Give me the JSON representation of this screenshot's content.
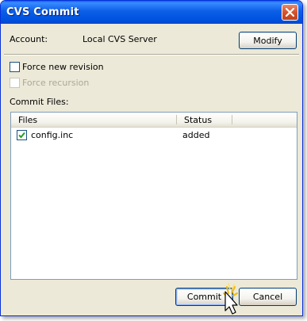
{
  "window": {
    "title": "CVS Commit"
  },
  "account": {
    "label": "Account:",
    "value": "Local CVS Server",
    "modify_label": "Modify"
  },
  "options": {
    "force_new_revision": {
      "label": "Force new revision",
      "checked": false
    },
    "force_recursion": {
      "label": "Force recursion",
      "checked": false,
      "enabled": false
    }
  },
  "commit_files": {
    "label": "Commit Files:",
    "columns": [
      "Files",
      "Status"
    ],
    "rows": [
      {
        "file": "config.inc",
        "status": "added",
        "checked": true
      }
    ]
  },
  "buttons": {
    "commit": "Commit",
    "cancel": "Cancel"
  },
  "icons": {
    "close": "close-icon",
    "checkmark": "checkmark-icon",
    "cursor": "mouse-pointer-icon",
    "click": "click-burst-icon"
  },
  "colors": {
    "titlebar": "#0054e3",
    "dialog_bg": "#ece9d8",
    "check_green": "#21a121",
    "close_red": "#d5542c"
  }
}
